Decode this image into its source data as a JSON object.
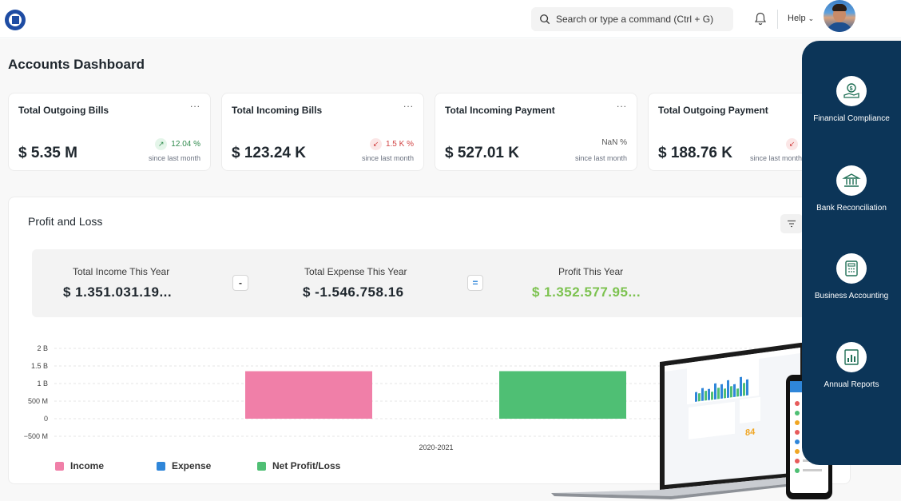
{
  "navbar": {
    "search_placeholder": "Search or type a command (Ctrl + G)",
    "help_label": "Help"
  },
  "page": {
    "title": "Accounts Dashboard"
  },
  "cards": [
    {
      "label": "Total Outgoing Bills",
      "value": "$ 5.35 M",
      "change": "12.04 %",
      "direction": "up",
      "since": "since last month"
    },
    {
      "label": "Total Incoming Bills",
      "value": "$ 123.24 K",
      "change": "1.5 K %",
      "direction": "down",
      "since": "since last month"
    },
    {
      "label": "Total Incoming Payment",
      "value": "$ 527.01 K",
      "change": "NaN %",
      "direction": "none",
      "since": "since last month"
    },
    {
      "label": "Total Outgoing Payment",
      "value": "$ 188.76 K",
      "change": "",
      "direction": "down",
      "since": "since last month"
    }
  ],
  "card_menu": "...",
  "profit_loss": {
    "title": "Profit and Loss",
    "income_label": "Total Income This Year",
    "income_value": "$ 1.351.031.19...",
    "minus": "-",
    "expense_label": "Total Expense This Year",
    "expense_value": "$ -1.546.758.16",
    "equals": "=",
    "profit_label": "Profit This Year",
    "profit_value": "$ 1.352.577.95..."
  },
  "chart_data": {
    "type": "bar",
    "categories": [
      "2020-2021"
    ],
    "series": [
      {
        "name": "Income",
        "values": [
          1351031190
        ],
        "color": "#f07fa8"
      },
      {
        "name": "Expense",
        "values": [
          0
        ],
        "color": "#2f86d9"
      },
      {
        "name": "Net Profit/Loss",
        "values": [
          1352577950
        ],
        "color": "#4fbf74"
      }
    ],
    "y_ticks": [
      "2 B",
      "1.5 B",
      "1 B",
      "500 M",
      "0",
      "−500 M"
    ],
    "ylim": [
      -500000000,
      2000000000
    ],
    "grid": true,
    "legend": "bottom-left"
  },
  "side_panel": {
    "features": [
      {
        "label": "Financial Compliance",
        "icon": "hand-dollar-icon"
      },
      {
        "label": "Bank Reconciliation",
        "icon": "bank-icon"
      },
      {
        "label": "Business Accounting",
        "icon": "calculator-icon"
      },
      {
        "label": "Annual Reports",
        "icon": "report-chart-icon"
      }
    ]
  },
  "colors": {
    "panel": "#0c3558",
    "profit_green": "#7cc24f",
    "up": "#2f8a4c",
    "down": "#d14343"
  }
}
